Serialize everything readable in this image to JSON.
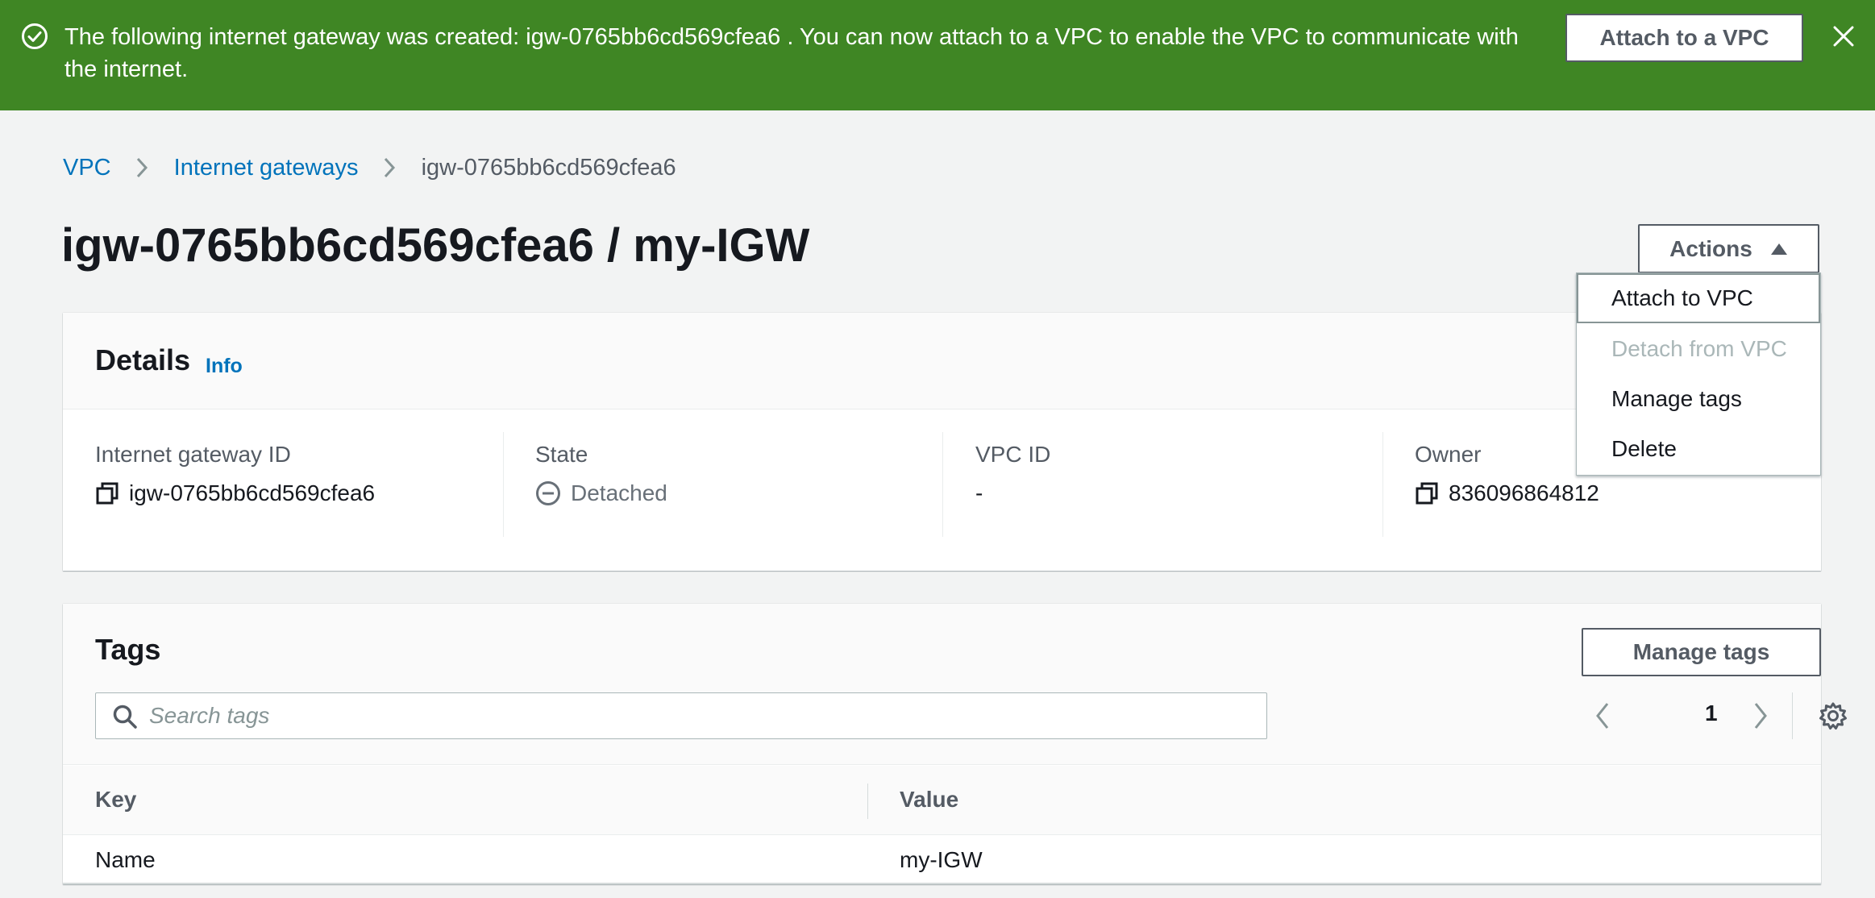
{
  "flash": {
    "message": "The following internet gateway was created: igw-0765bb6cd569cfea6 . You can now attach to a VPC to enable the VPC to communicate with the internet.",
    "action_label": "Attach to a VPC",
    "success_icon": "check-circle-icon",
    "close_icon": "close-icon"
  },
  "breadcrumb": {
    "items": [
      "VPC",
      "Internet gateways",
      "igw-0765bb6cd569cfea6"
    ]
  },
  "page": {
    "title": "igw-0765bb6cd569cfea6 / my-IGW"
  },
  "actions": {
    "label": "Actions",
    "menu": [
      {
        "label": "Attach to VPC",
        "disabled": false
      },
      {
        "label": "Detach from VPC",
        "disabled": true
      },
      {
        "label": "Manage tags",
        "disabled": false
      },
      {
        "label": "Delete",
        "disabled": false
      }
    ]
  },
  "details": {
    "title": "Details",
    "info_label": "Info",
    "fields": [
      {
        "label": "Internet gateway ID",
        "value": "igw-0765bb6cd569cfea6",
        "icon": "copy-icon"
      },
      {
        "label": "State",
        "value": "Detached",
        "icon": "minus-circle-icon"
      },
      {
        "label": "VPC ID",
        "value": "-"
      },
      {
        "label": "Owner",
        "value": "836096864812",
        "icon": "copy-icon"
      }
    ]
  },
  "tags": {
    "title": "Tags",
    "manage_label": "Manage tags",
    "search_placeholder": "Search tags",
    "search_value": "",
    "page_number": "1",
    "columns": [
      "Key",
      "Value"
    ],
    "rows": [
      {
        "key": "Name",
        "value": "my-IGW"
      }
    ]
  },
  "colors": {
    "flash_success": "#3f8624",
    "link": "#0073bb",
    "background": "#f2f3f3"
  }
}
